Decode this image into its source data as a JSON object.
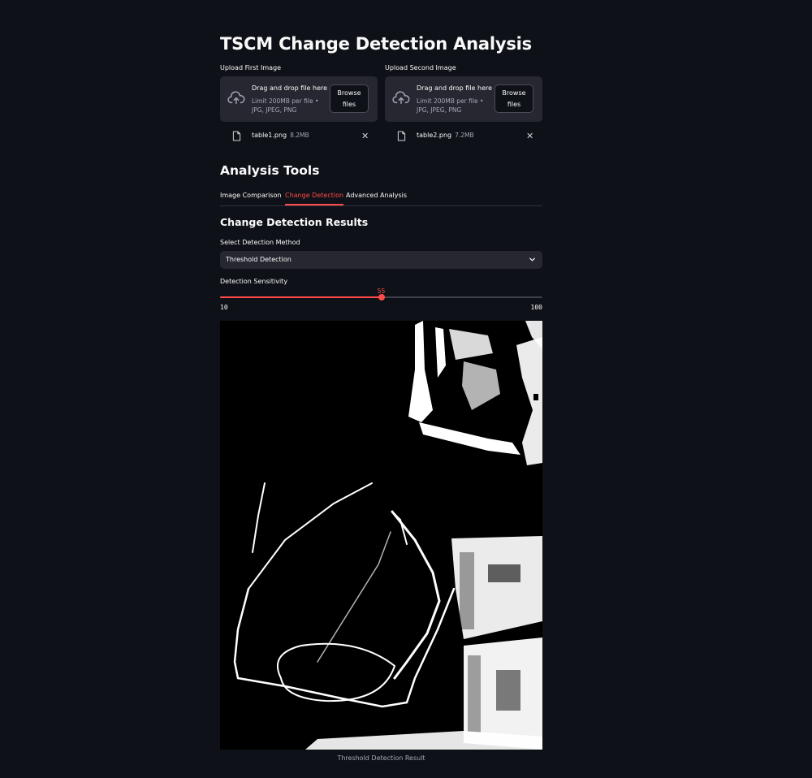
{
  "page": {
    "title": "TSCM Change Detection Analysis"
  },
  "uploaders": [
    {
      "label": "Upload First Image",
      "drop_text": "Drag and drop file here",
      "limit_text": "Limit 200MB per file • JPG, JPEG, PNG",
      "browse_label": "Browse files",
      "file_name": "table1.png",
      "file_size": "8.2MB"
    },
    {
      "label": "Upload Second Image",
      "drop_text": "Drag and drop file here",
      "limit_text": "Limit 200MB per file • JPG, JPEG, PNG",
      "browse_label": "Browse files",
      "file_name": "table2.png",
      "file_size": "7.2MB"
    }
  ],
  "analysis": {
    "section_title": "Analysis Tools",
    "tabs": [
      {
        "label": "Image Comparison",
        "active": false
      },
      {
        "label": "Change Detection",
        "active": true
      },
      {
        "label": "Advanced Analysis",
        "active": false
      }
    ],
    "results_title": "Change Detection Results",
    "method": {
      "label": "Select Detection Method",
      "value": "Threshold Detection"
    },
    "sensitivity": {
      "label": "Detection Sensitivity",
      "value": "55",
      "min": "10",
      "max": "100"
    },
    "result_caption": "Threshold Detection Result"
  },
  "colors": {
    "background": "#0e1117",
    "accent": "#ff4b4b",
    "surface": "#262730"
  },
  "icons": {
    "upload": "cloud-upload-icon",
    "file": "file-icon",
    "close": "close-icon",
    "dropdown": "chevron-down-icon"
  }
}
